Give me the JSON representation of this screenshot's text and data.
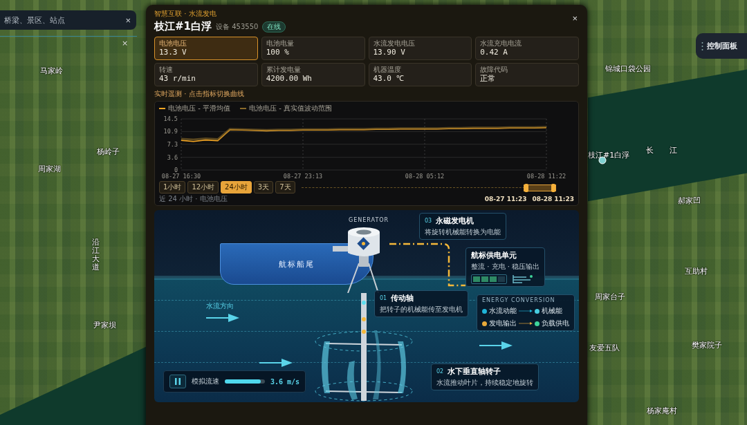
{
  "map": {
    "labels": [
      "马家岭",
      "杨岭子",
      "周家湖",
      "沿江大道",
      "尹家坝",
      "锦城口袋公园",
      "枝江#1白浮",
      "长",
      "江",
      "郝家凹",
      "互助村",
      "周家台子",
      "友爱五队",
      "樊家院子",
      "杨家庵村"
    ],
    "search": {
      "placeholder": "桥梁、景区、站点",
      "clear": "×"
    },
    "close_mark": "×",
    "control_panel": {
      "label": "控制面板"
    }
  },
  "panel": {
    "breadcrumb": "智慧互联 · 水流发电",
    "title": "枝江#1白浮",
    "device": "设备 453550",
    "status": "在线",
    "close": "×",
    "metrics": [
      {
        "label": "电池电压",
        "value": "13.3 V",
        "selected": true
      },
      {
        "label": "电池电量",
        "value": "100 %",
        "selected": false
      },
      {
        "label": "水流发电电压",
        "value": "13.90 V",
        "selected": false
      },
      {
        "label": "水流充电电流",
        "value": "0.42 A",
        "selected": false
      },
      {
        "label": "转速",
        "value": "43 r/min",
        "selected": false
      },
      {
        "label": "累计发电量",
        "value": "4200.00 Wh",
        "selected": false
      },
      {
        "label": "机器温度",
        "value": "43.0 ℃",
        "selected": false
      },
      {
        "label": "故障代码",
        "value": "正常",
        "selected": false
      }
    ],
    "telemetry_hint": "实时遥测 · 点击指标切换曲线",
    "chart": {
      "chart_data": {
        "type": "line",
        "categories": [
          "08-27 16:30",
          null,
          null,
          null,
          null,
          null,
          null,
          null,
          null,
          null,
          "08-27 23:13",
          null,
          null,
          null,
          null,
          null,
          null,
          null,
          null,
          null,
          "08-28 05:12",
          null,
          null,
          null,
          null,
          null,
          null,
          null,
          null,
          null,
          "08-28 11:22"
        ],
        "series": [
          {
            "name": "电池电压 - 平滑均值",
            "color": "#f5a623",
            "values": [
              8.4,
              8.1,
              8.5,
              8.3,
              11.4,
              11.3,
              11.2,
              11.1,
              11.2,
              11.2,
              11.3,
              11.3,
              11.3,
              11.4,
              11.4,
              11.4,
              11.5,
              11.5,
              11.6,
              11.6,
              11.6,
              11.6,
              11.7,
              11.7,
              11.8,
              11.8,
              11.8,
              11.9,
              11.9,
              11.9,
              12.0
            ]
          },
          {
            "name": "电池电压 - 真实值波动范围",
            "color": "#8a6a2a",
            "values": [
              8.8,
              8.6,
              8.9,
              8.7,
              11.6,
              11.5,
              11.4,
              11.3,
              11.4,
              11.4,
              11.5,
              11.5,
              11.5,
              11.6,
              11.6,
              11.6,
              11.7,
              11.7,
              11.8,
              11.8,
              11.8,
              11.8,
              11.9,
              11.9,
              12.0,
              12.0,
              12.0,
              12.1,
              12.1,
              12.1,
              12.2
            ]
          }
        ],
        "ylim": [
          0,
          14.5
        ],
        "yticks": [
          0,
          3.6,
          7.3,
          10.9,
          14.5
        ],
        "grid": true
      },
      "ranges": [
        {
          "label": "1小时",
          "selected": false
        },
        {
          "label": "12小时",
          "selected": false
        },
        {
          "label": "24小时",
          "selected": true
        },
        {
          "label": "3天",
          "selected": false
        },
        {
          "label": "7天",
          "selected": false
        }
      ],
      "window": {
        "level": 0.15
      },
      "window_start": "08-27 11:23",
      "window_end": "08-28 11:23",
      "caption": "近 24 小时 · 电池电压"
    },
    "diagram": {
      "generator_tag": "GENERATOR",
      "boat": "航标船尾",
      "flow_direction": "水流方向",
      "callouts": [
        {
          "number": "03",
          "title": "永磁发电机",
          "text": "将旋转机械能转换为电能"
        },
        {
          "number": "01",
          "title": "传动轴",
          "text": "把转子的机械能传至发电机"
        },
        {
          "number": "02",
          "title": "水下垂直轴转子",
          "text": "水流推动叶片，持续稳定地旋转"
        }
      ],
      "power_unit": {
        "title": "航标供电单元",
        "text": "整流 · 充电 · 稳压输出",
        "level": 0.75
      },
      "energy": {
        "title": "ENERGY CONVERSION",
        "flows": [
          {
            "from": {
              "label": "水流动能",
              "color": "#1fb4d8"
            },
            "to": {
              "label": "机械能",
              "color": "#48cde0"
            }
          },
          {
            "from": {
              "label": "发电输出",
              "color": "#e8a93a"
            },
            "to": {
              "label": "负载供电",
              "color": "#3ed39a"
            }
          }
        ]
      },
      "control": {
        "playing": true,
        "label": "模拟流速",
        "level": 0.9,
        "reading": "3.6 m/s"
      }
    }
  }
}
